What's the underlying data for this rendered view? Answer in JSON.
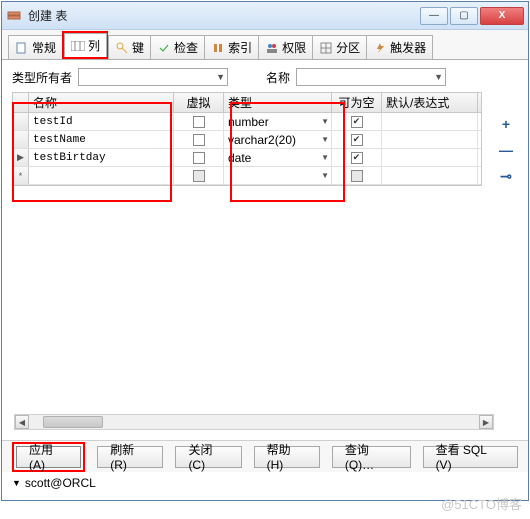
{
  "window": {
    "title": "创建 表"
  },
  "winbtns": {
    "min": "—",
    "max": "▢",
    "close": "X"
  },
  "tabs": [
    {
      "label": "常规",
      "icon": "page"
    },
    {
      "label": "列",
      "icon": "col",
      "active": true,
      "highlighted": true
    },
    {
      "label": "键",
      "icon": "key"
    },
    {
      "label": "检查",
      "icon": "check"
    },
    {
      "label": "索引",
      "icon": "index"
    },
    {
      "label": "权限",
      "icon": "perm"
    },
    {
      "label": "分区",
      "icon": "part"
    },
    {
      "label": "触发器",
      "icon": "trig"
    }
  ],
  "filters": {
    "owner_label": "类型所有者",
    "name_label": "名称"
  },
  "grid": {
    "headers": {
      "name": "名称",
      "virtual": "虚拟",
      "type": "类型",
      "nullable": "可为空",
      "default": "默认/表达式"
    },
    "rows": [
      {
        "marker": "",
        "name": "testId",
        "virtual": false,
        "type": "number",
        "nullable": true,
        "default": ""
      },
      {
        "marker": "",
        "name": "testName",
        "virtual": false,
        "type": "varchar2(20)",
        "nullable": true,
        "default": ""
      },
      {
        "marker": "▶",
        "name": "testBirtday",
        "virtual": false,
        "type": "date",
        "nullable": true,
        "default": ""
      },
      {
        "marker": "*",
        "name": "",
        "virtual": false,
        "virtual_disabled": true,
        "type": "",
        "nullable": false,
        "nullable_disabled": true,
        "default": ""
      }
    ]
  },
  "sidebtns": {
    "add": "+",
    "remove": "—",
    "misc": "⊸"
  },
  "buttons": {
    "apply": "应用(A)",
    "refresh": "刷新(R)",
    "close": "关闭(C)",
    "help": "帮助(H)",
    "query": "查询(Q)…",
    "viewsql": "查看 SQL (V)"
  },
  "status": {
    "connection": "scott@ORCL"
  },
  "watermark": "@51CTO博客"
}
